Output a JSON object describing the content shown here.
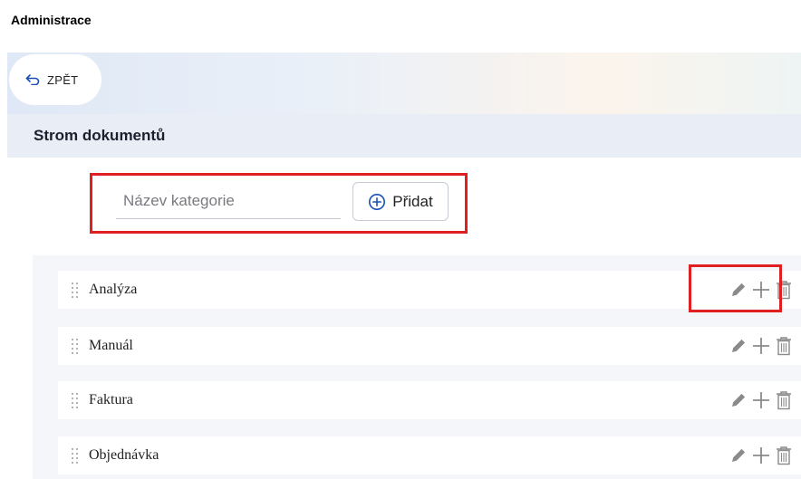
{
  "page": {
    "header": "Administrace"
  },
  "toolbar": {
    "back_label": "ZPĚT"
  },
  "section": {
    "title": "Strom dokumentů"
  },
  "add_category": {
    "placeholder": "Název kategorie",
    "value": "",
    "button_label": "Přidat"
  },
  "tree": {
    "items": [
      {
        "label": "Analýza"
      },
      {
        "label": "Manuál"
      },
      {
        "label": "Faktura"
      },
      {
        "label": "Objednávka"
      }
    ]
  },
  "icons": {
    "back": "undo-arrow-icon",
    "add": "plus-circle-icon",
    "drag": "drag-handle-icon",
    "edit": "pencil-icon",
    "add_child": "plus-icon",
    "delete": "trash-icon"
  },
  "colors": {
    "highlight": "#e02020",
    "accent": "#1a4fb5",
    "section_bg": "#e9eef6",
    "icon_gray": "#8a8a8a"
  }
}
